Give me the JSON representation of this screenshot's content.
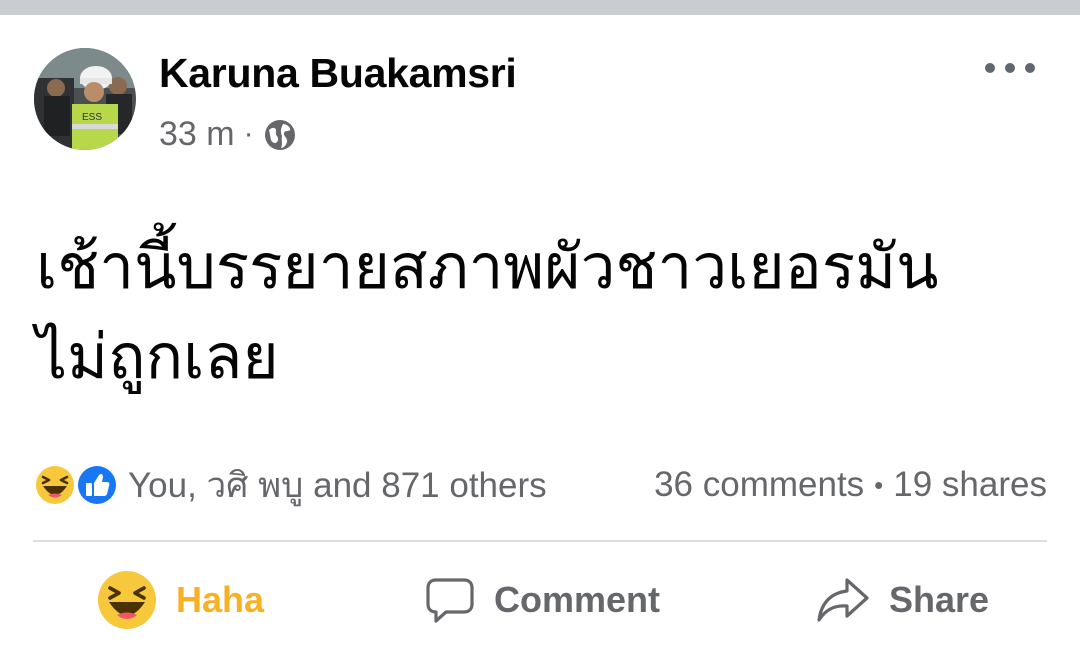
{
  "post": {
    "author": "Karuna Buakamsri",
    "time": "33 m",
    "separator": "·",
    "privacy_icon": "globe-icon",
    "text_line1": "เช้านี้บรรยายสภาพผัวชาวเยอรมัน",
    "text_line2": "ไม่ถูกเลย"
  },
  "engagement": {
    "reaction_icons": [
      "haha-icon",
      "like-icon"
    ],
    "reaction_summary": "You, วศิ พบู and 871 others",
    "comments": "36 comments",
    "dot": "•",
    "shares": "19 shares"
  },
  "actions": {
    "haha_label": "Haha",
    "comment_label": "Comment",
    "share_label": "Share"
  },
  "colors": {
    "haha_accent": "#f7b125",
    "like_blue": "#1877f2",
    "secondary_text": "#65676b",
    "divider": "#dadde1"
  }
}
